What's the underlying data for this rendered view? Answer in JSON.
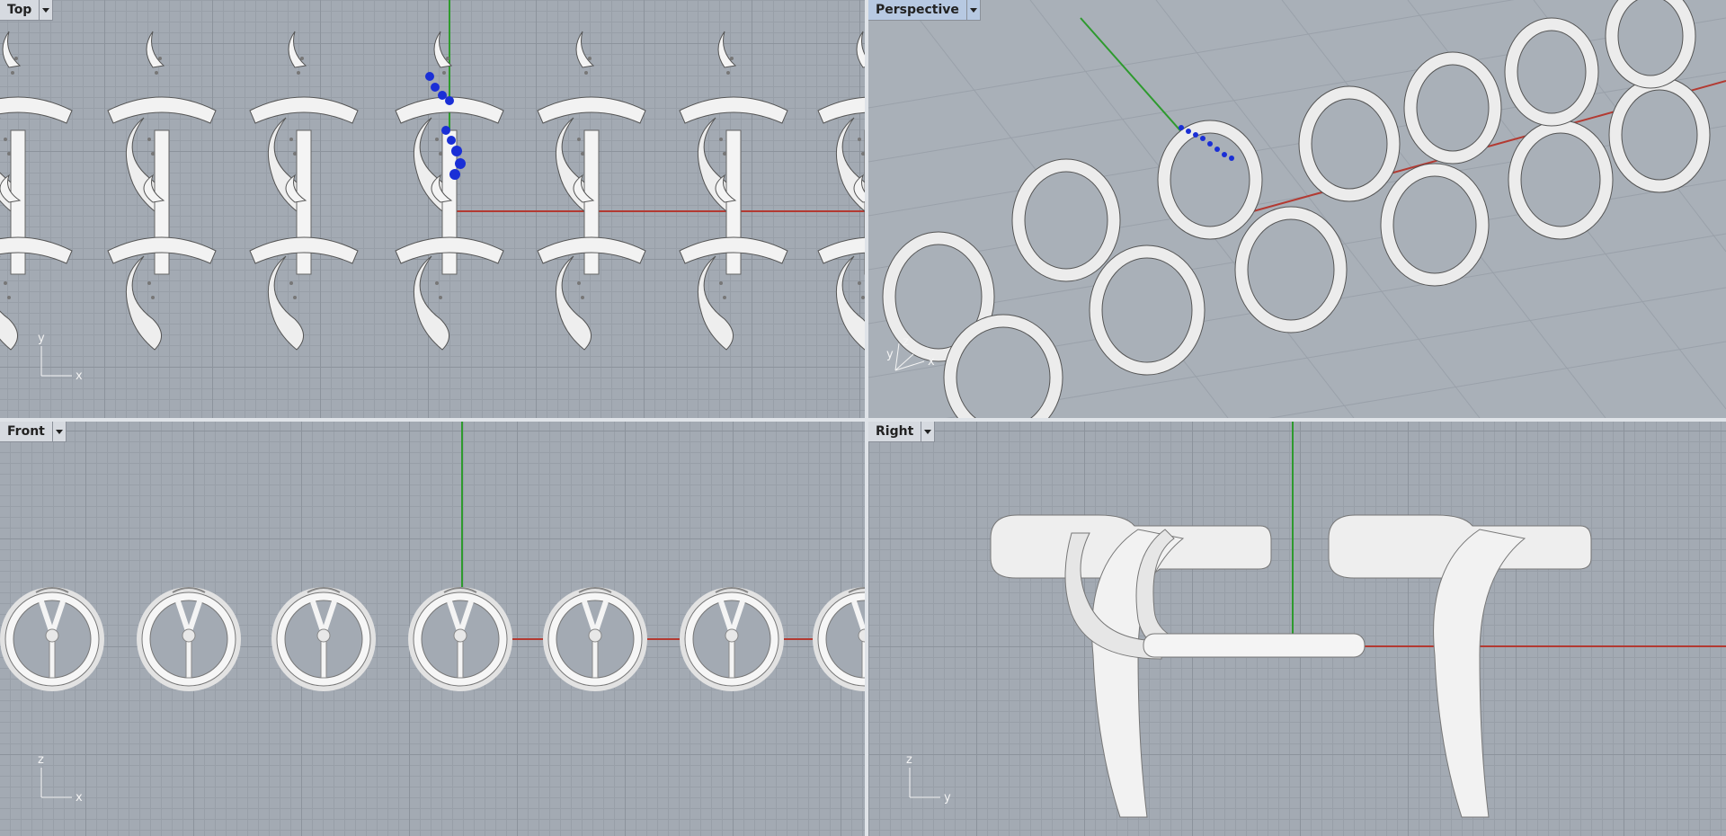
{
  "viewports": {
    "top": {
      "label": "Top",
      "axis_h": "x",
      "axis_v": "y",
      "dropdown_icon": "chevron-down-icon"
    },
    "persp": {
      "label": "Perspective",
      "axis_h": "x",
      "axis_v": "z",
      "axis_d": "y",
      "dropdown_icon": "chevron-down-icon"
    },
    "front": {
      "label": "Front",
      "axis_h": "x",
      "axis_v": "z",
      "dropdown_icon": "chevron-down-icon"
    },
    "right": {
      "label": "Right",
      "axis_h": "y",
      "axis_v": "z",
      "dropdown_icon": "chevron-down-icon"
    }
  },
  "colors": {
    "viewport_bg": "#a3aab3",
    "active_tab": "#b7c9e2",
    "x_axis": "#b33a32",
    "y_axis": "#2e9a2e",
    "selected_gems": "#1a2fd6",
    "model": "#f2f2f2"
  }
}
